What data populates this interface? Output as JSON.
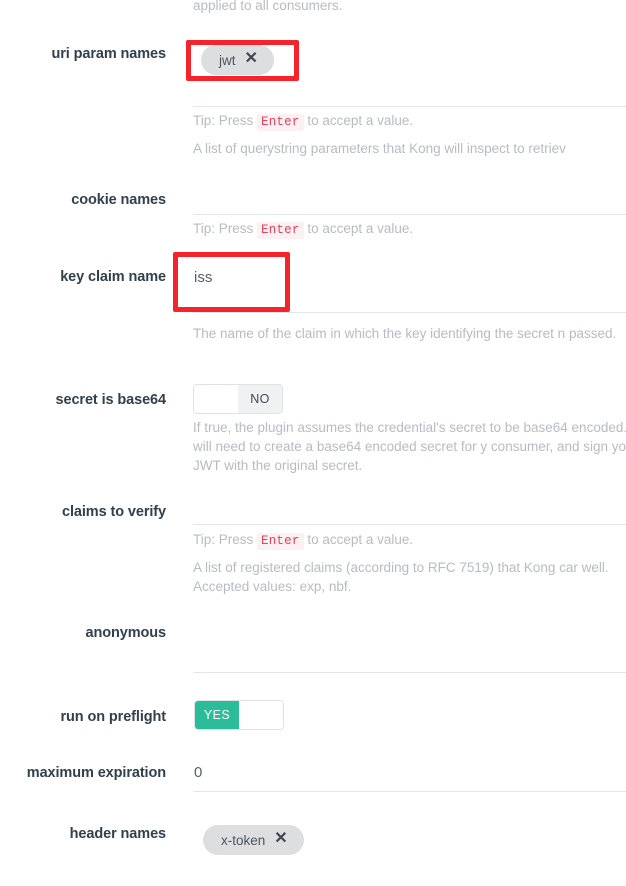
{
  "meta": {
    "accent_green": "#2bbd9a",
    "accent_red": "#f5232b",
    "label_color": "#32404e",
    "help_color": "#b6bcc4",
    "chip_bg": "#dcdee0",
    "kbd_color": "#e8415a"
  },
  "top_partial_text": "applied to all consumers.",
  "tips": {
    "prefix": "Tip: Press",
    "key": "Enter",
    "suffix": "to accept a value."
  },
  "fields": {
    "uri_param_names": {
      "label": "uri param names",
      "chip": "jwt",
      "chip_remove_icon": "close-icon",
      "description": "A list of querystring parameters that Kong will inspect to retriev"
    },
    "cookie_names": {
      "label": "cookie names",
      "value": ""
    },
    "key_claim_name": {
      "label": "key claim name",
      "value": "iss",
      "description": "The name of the claim in which the key identifying the secret n passed."
    },
    "secret_is_base64": {
      "label": "secret is base64",
      "state": "NO",
      "on_label": "YES",
      "off_label": "NO",
      "description": "If true, the plugin assumes the credential's secret to be base64 encoded. You will need to create a base64 encoded secret for y consumer, and sign your JWT with the original secret."
    },
    "claims_to_verify": {
      "label": "claims to verify",
      "value": "",
      "description": "A list of registered claims (according to RFC 7519) that Kong car well. Accepted values: exp, nbf."
    },
    "anonymous": {
      "label": "anonymous",
      "value": ""
    },
    "run_on_preflight": {
      "label": "run on preflight",
      "state": "YES",
      "on_label": "YES",
      "off_label": "NO"
    },
    "maximum_expiration": {
      "label": "maximum expiration",
      "value": "0"
    },
    "header_names": {
      "label": "header names",
      "chip": "x-token",
      "chip_remove_icon": "close-icon"
    }
  }
}
